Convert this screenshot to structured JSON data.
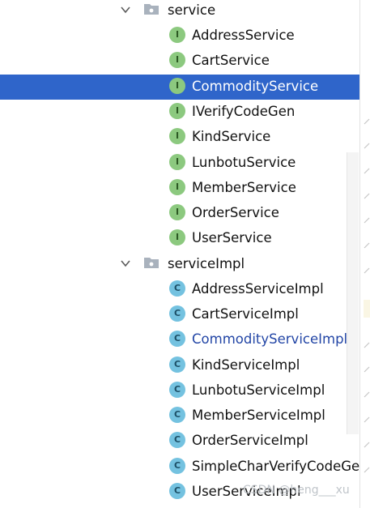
{
  "tree": {
    "packages": [
      {
        "name": "service",
        "items": [
          {
            "name": "AddressService",
            "kind": "I"
          },
          {
            "name": "CartService",
            "kind": "I"
          },
          {
            "name": "CommodityService",
            "kind": "I",
            "selected": true
          },
          {
            "name": "IVerifyCodeGen",
            "kind": "I"
          },
          {
            "name": "KindService",
            "kind": "I"
          },
          {
            "name": "LunbotuService",
            "kind": "I"
          },
          {
            "name": "MemberService",
            "kind": "I"
          },
          {
            "name": "OrderService",
            "kind": "I"
          },
          {
            "name": "UserService",
            "kind": "I"
          }
        ]
      },
      {
        "name": "serviceImpl",
        "items": [
          {
            "name": "AddressServiceImpl",
            "kind": "C"
          },
          {
            "name": "CartServiceImpl",
            "kind": "C"
          },
          {
            "name": "CommodityServiceImpl",
            "kind": "C",
            "highlighted": true
          },
          {
            "name": "KindServiceImpl",
            "kind": "C"
          },
          {
            "name": "LunbotuServiceImpl",
            "kind": "C"
          },
          {
            "name": "MemberServiceImpl",
            "kind": "C"
          },
          {
            "name": "OrderServiceImpl",
            "kind": "C"
          },
          {
            "name": "SimpleCharVerifyCodeGe",
            "kind": "C"
          },
          {
            "name": "UserServiceImpl",
            "kind": "C"
          }
        ]
      }
    ]
  },
  "icons": {
    "expand": "chevron-down-icon",
    "package": "folder-icon",
    "interface": "interface-icon",
    "class": "class-icon"
  },
  "colors": {
    "selection": "#2f65ca",
    "interface_badge": "#8cc97f",
    "class_badge": "#74c2e0",
    "link_text": "#2346a6"
  },
  "watermark": "CSDN @heng___xu"
}
